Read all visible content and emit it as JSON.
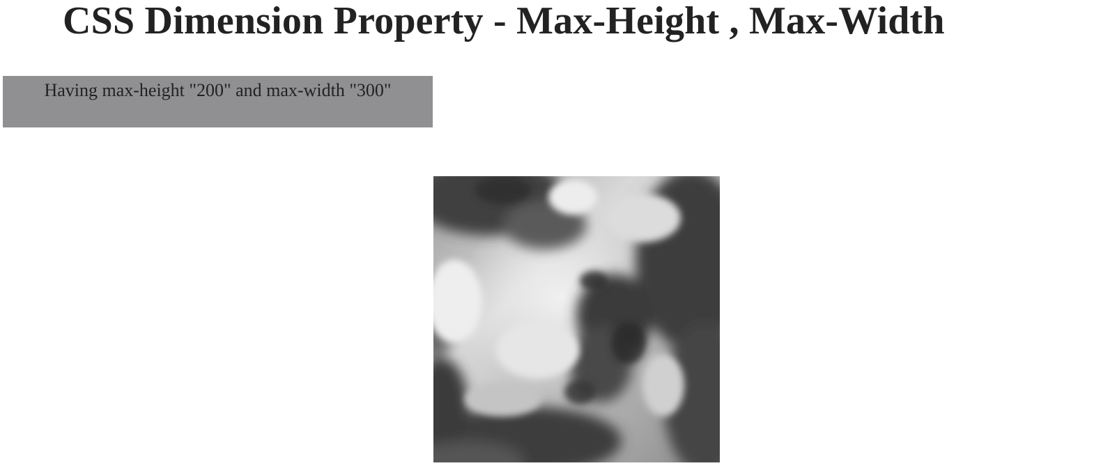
{
  "page": {
    "title": "CSS Dimension Property - Max-Height , Max-Width"
  },
  "demo_box": {
    "text": "Having max-height \"200\" and max-width \"300\"",
    "background_color": "#909093"
  },
  "image": {
    "alt": "clouds"
  }
}
